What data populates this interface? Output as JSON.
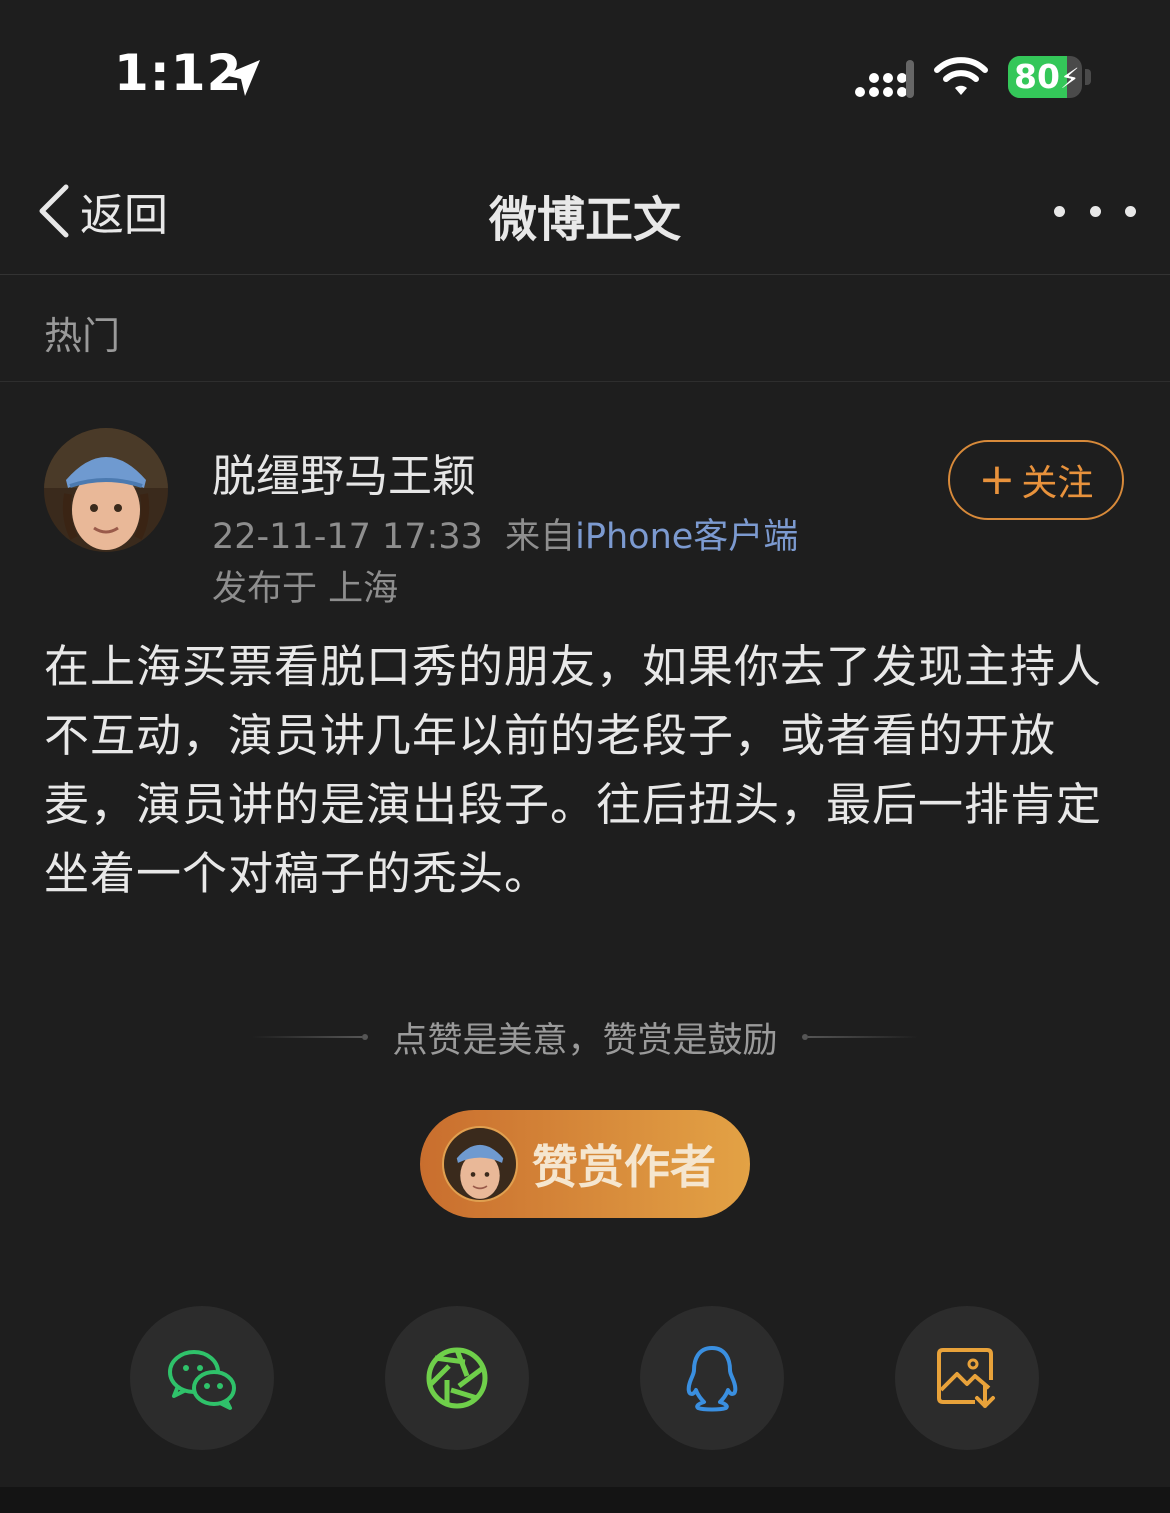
{
  "status_bar": {
    "time": "1:12",
    "battery_level": "80",
    "battery_fraction": 0.8
  },
  "nav": {
    "back_label": "返回",
    "title": "微博正文"
  },
  "section": {
    "label": "热门"
  },
  "author": {
    "name": "脱缰野马王颖",
    "timestamp": "22-11-17 17:33",
    "source_prefix": "来自",
    "source_name": "iPhone客户端",
    "location": "发布于 上海",
    "follow_label": "关注"
  },
  "post": {
    "text": "在上海买票看脱口秀的朋友，如果你去了发现主持人不互动，演员讲几年以前的老段子，或者看的开放麦，演员讲的是演出段子。往后扭头，最后一排肯定坐着一个对稿子的秃头。"
  },
  "reward": {
    "hint": "点赞是美意，赞赏是鼓励",
    "button_label": "赞赏作者"
  },
  "share": {
    "items": [
      {
        "icon": "wechat-icon",
        "color": "#2fc26a"
      },
      {
        "icon": "moments-icon",
        "color": "#6fcf4a"
      },
      {
        "icon": "qq-icon",
        "color": "#3a8fe0"
      },
      {
        "icon": "save-image-icon",
        "color": "#e8a23a"
      }
    ]
  }
}
